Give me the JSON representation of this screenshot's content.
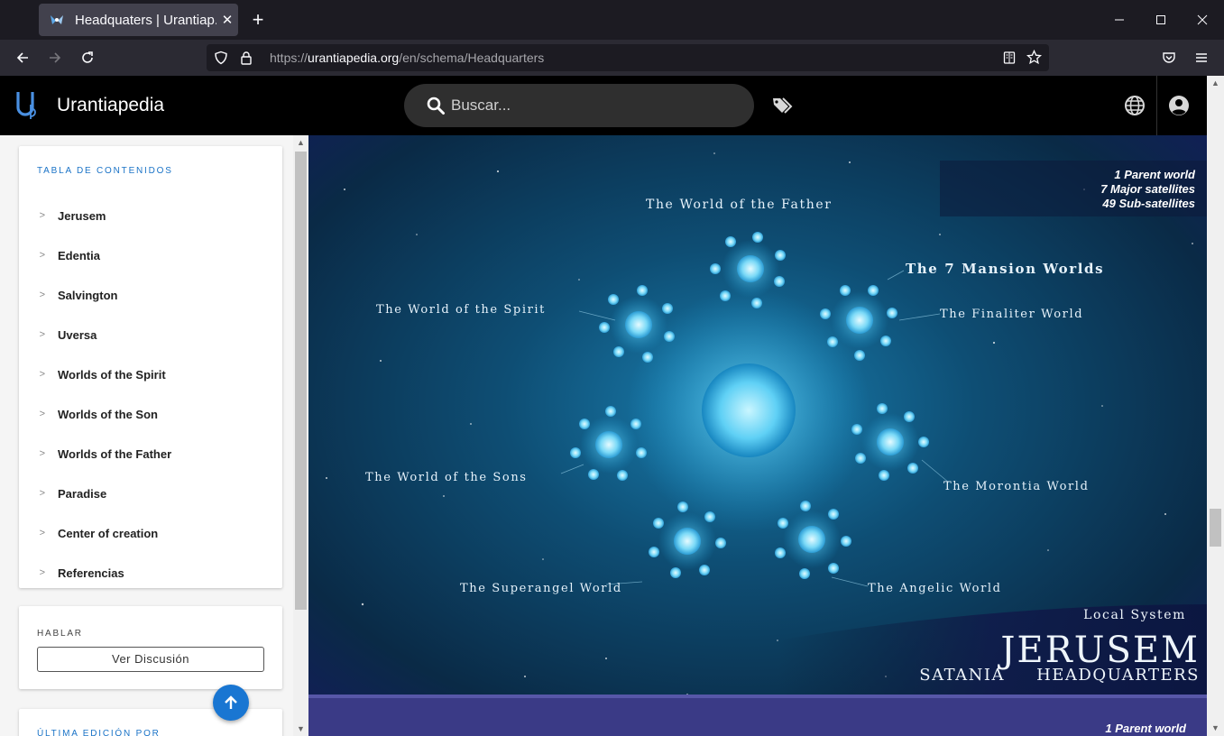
{
  "browser": {
    "tab_title": "Headquaters | Urantiap..",
    "url_scheme": "https://",
    "url_host": "urantiapedia.org",
    "url_path": "/en/schema/Headquarters"
  },
  "header": {
    "brand": "Urantiapedia",
    "search_placeholder": "Buscar..."
  },
  "sidebar": {
    "toc_title": "TABLA DE CONTENIDOS",
    "toc_items": [
      {
        "label": "Jerusem"
      },
      {
        "label": "Edentia"
      },
      {
        "label": "Salvington"
      },
      {
        "label": "Uversa"
      },
      {
        "label": "Worlds of the Spirit"
      },
      {
        "label": "Worlds of the Son"
      },
      {
        "label": "Worlds of the Father"
      },
      {
        "label": "Paradise"
      },
      {
        "label": "Center of creation"
      },
      {
        "label": "Referencias"
      }
    ],
    "talk_title": "HABLAR",
    "talk_button": "Ver Discusión",
    "last_edit_title": "ÚLTIMA EDICIÓN POR"
  },
  "diagram": {
    "top_right_lines": [
      "1 Parent world",
      "7 Major satellites",
      "49 Sub-satellites"
    ],
    "label_father": "The World of the Father",
    "label_mansion": "The 7 Mansion Worlds",
    "label_finaliter": "The Finaliter World",
    "label_spirit": "The World of the Spirit",
    "label_sons": "The World of the Sons",
    "label_morontia": "The Morontia World",
    "label_superangel": "The Superangel World",
    "label_angelic": "The Angelic World",
    "local_system": "Local System",
    "jerusem": "JERUSEM",
    "satania": "SATANIA",
    "headquarters": "HEADQUARTERS",
    "bottom_line": "1 Parent world"
  },
  "colors": {
    "accent": "#1976d2",
    "toc_title": "#1a73c7",
    "header_bg": "#000000",
    "browser_bg": "#1c1b22"
  }
}
